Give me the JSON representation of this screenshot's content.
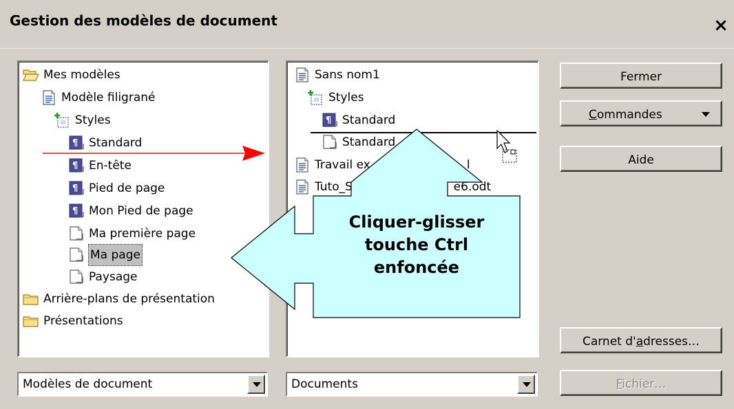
{
  "dialog": {
    "title": "Gestion des modèles de document",
    "close_label": "×"
  },
  "left_tree": {
    "items": [
      {
        "label": "Mes modèles",
        "icon": "folder-open-icon"
      },
      {
        "label": "Modèle filigrané",
        "icon": "document-icon"
      },
      {
        "label": "Styles",
        "icon": "styles-icon"
      },
      {
        "label": "Standard",
        "icon": "paragraph-style-icon"
      },
      {
        "label": "En-tête",
        "icon": "paragraph-style-icon"
      },
      {
        "label": "Pied de page",
        "icon": "paragraph-style-icon"
      },
      {
        "label": "Mon Pied de page",
        "icon": "paragraph-style-icon"
      },
      {
        "label": "Ma première page",
        "icon": "page-style-icon"
      },
      {
        "label": "Ma page",
        "icon": "page-style-icon"
      },
      {
        "label": "Paysage",
        "icon": "page-style-icon"
      },
      {
        "label": "Arrière-plans de présentation",
        "icon": "folder-icon"
      },
      {
        "label": "Présentations",
        "icon": "folder-icon"
      }
    ]
  },
  "right_tree": {
    "items": [
      {
        "label": "Sans nom1",
        "icon": "document-icon"
      },
      {
        "label": "Styles",
        "icon": "styles-icon"
      },
      {
        "label": "Standard",
        "icon": "paragraph-style-icon"
      },
      {
        "label": "Standard",
        "icon": "page-style-icon"
      },
      {
        "label": "Travail ex",
        "icon": "document-icon"
      },
      {
        "label": "Tuto_Sty",
        "icon": "document-icon"
      }
    ],
    "travail_suffix": "l",
    "tuto_suffix": "e6.odt"
  },
  "buttons": {
    "fermer": "Fermer",
    "commandes_underlined": "C",
    "commandes_rest": "ommandes",
    "aide": "Aide",
    "carnet_pre": "Carnet d'",
    "carnet_underlined": "a",
    "carnet_post": "dresses…",
    "fichier_underlined": "F",
    "fichier_rest": "ichier…"
  },
  "combos": {
    "left_value": "Modèles de document",
    "right_value": "Documents"
  },
  "annotation": {
    "line1": "Cliquer-glisser",
    "line2": "touche Ctrl",
    "line3": "enfoncée"
  },
  "colors": {
    "dialog_bg": "#d4d0c8",
    "annotation_fill": "#ccffff",
    "arrow_red": "#ff0000",
    "paragraph_icon": "#4040a0"
  }
}
